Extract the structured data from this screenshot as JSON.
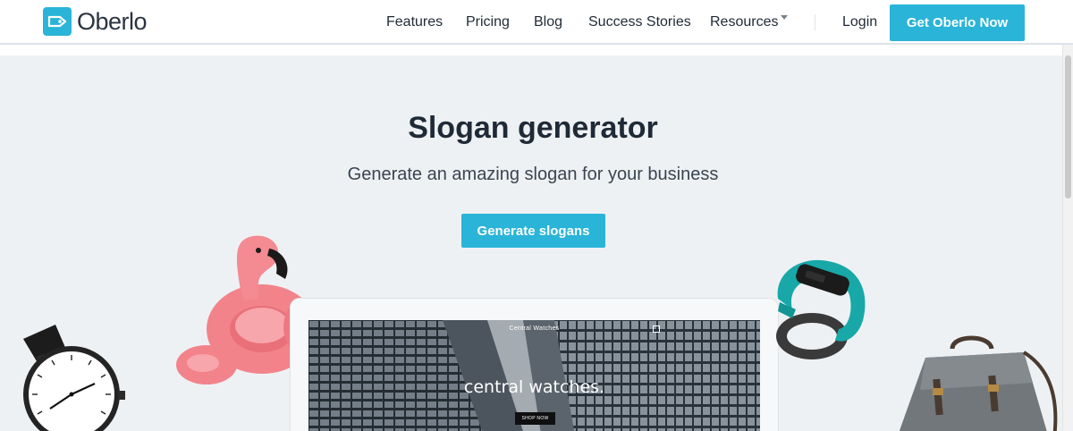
{
  "brand": {
    "name": "Oberlo",
    "logo_icon": "price-tag-icon",
    "accent_color": "#2ab4d8"
  },
  "nav": {
    "links": [
      "Features",
      "Pricing",
      "Blog",
      "Success Stories",
      "Resources"
    ],
    "resources_has_dropdown": true,
    "login_label": "Login",
    "cta_label": "Get Oberlo Now"
  },
  "hero": {
    "title": "Slogan generator",
    "subtitle": "Generate an amazing slogan for your business",
    "button_label": "Generate slogans"
  },
  "mockup": {
    "site_name": "Central Watches",
    "headline": "central watches.",
    "shop_button": "SHOP NOW"
  }
}
